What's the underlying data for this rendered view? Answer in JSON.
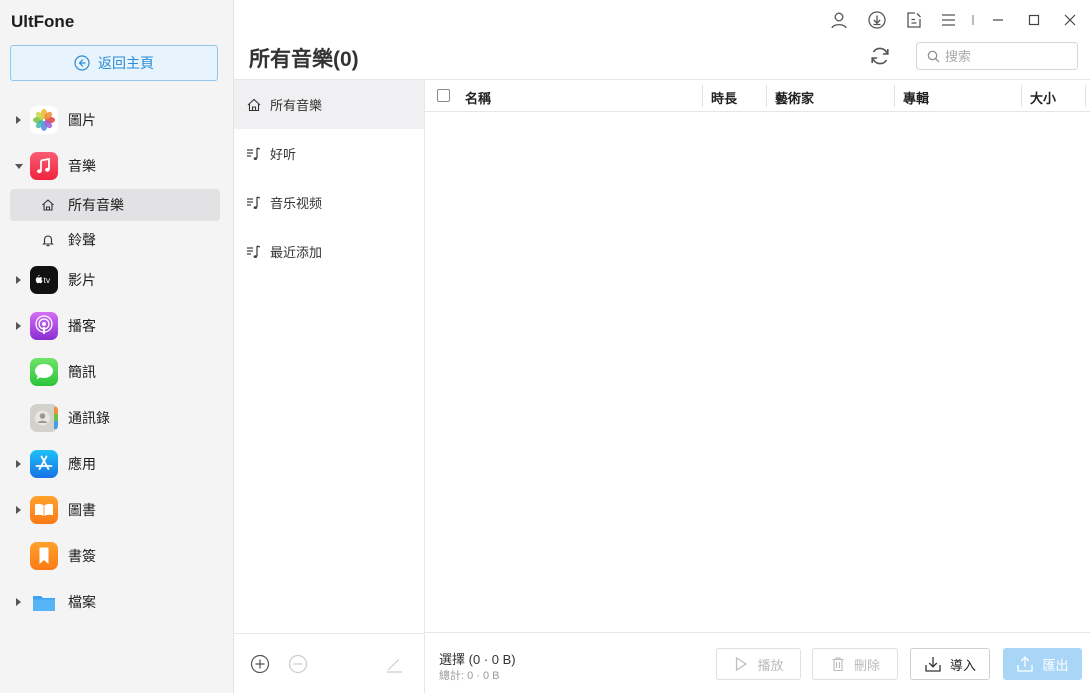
{
  "app": {
    "brand": "UltFone",
    "home_button": "返回主頁"
  },
  "sidebar": {
    "items": [
      {
        "label": "圖片",
        "icon": "photos-icon",
        "expandable": true,
        "expanded": false
      },
      {
        "label": "音樂",
        "icon": "music-icon",
        "expandable": true,
        "expanded": true
      },
      {
        "label": "影片",
        "icon": "apple-tv-icon",
        "expandable": true,
        "expanded": false
      },
      {
        "label": "播客",
        "icon": "podcasts-icon",
        "expandable": true,
        "expanded": false
      },
      {
        "label": "簡訊",
        "icon": "messages-icon",
        "expandable": false
      },
      {
        "label": "通訊錄",
        "icon": "contacts-icon",
        "expandable": false
      },
      {
        "label": "應用",
        "icon": "app-store-icon",
        "expandable": true,
        "expanded": false
      },
      {
        "label": "圖書",
        "icon": "books-icon",
        "expandable": true,
        "expanded": false
      },
      {
        "label": "書簽",
        "icon": "bookmark-icon",
        "expandable": false
      },
      {
        "label": "檔案",
        "icon": "folder-icon",
        "expandable": true,
        "expanded": false
      }
    ],
    "music_sub": [
      {
        "label": "所有音樂",
        "icon": "home-icon",
        "active": true
      },
      {
        "label": "鈴聲",
        "icon": "bell-icon",
        "active": false
      }
    ]
  },
  "header": {
    "title": "所有音樂(0)",
    "search_placeholder": "搜索"
  },
  "playlists": [
    {
      "label": "所有音樂",
      "icon": "home-icon",
      "active": true
    },
    {
      "label": "好听",
      "icon": "playlist-icon",
      "active": false
    },
    {
      "label": "音乐视频",
      "icon": "playlist-icon",
      "active": false
    },
    {
      "label": "最近添加",
      "icon": "playlist-icon",
      "active": false
    }
  ],
  "table": {
    "columns": [
      "名稱",
      "時長",
      "藝術家",
      "專輯",
      "大小"
    ],
    "rows": []
  },
  "footer": {
    "selection": "選擇 (0 · 0 B)",
    "total": "總計: 0 · 0 B",
    "play": "播放",
    "delete": "刪除",
    "import": "導入",
    "export": "匯出"
  },
  "colors": {
    "accent": "#2a8bd6",
    "export_button": "#a9d6f7",
    "sidebar_bg": "#f4f4f5"
  }
}
